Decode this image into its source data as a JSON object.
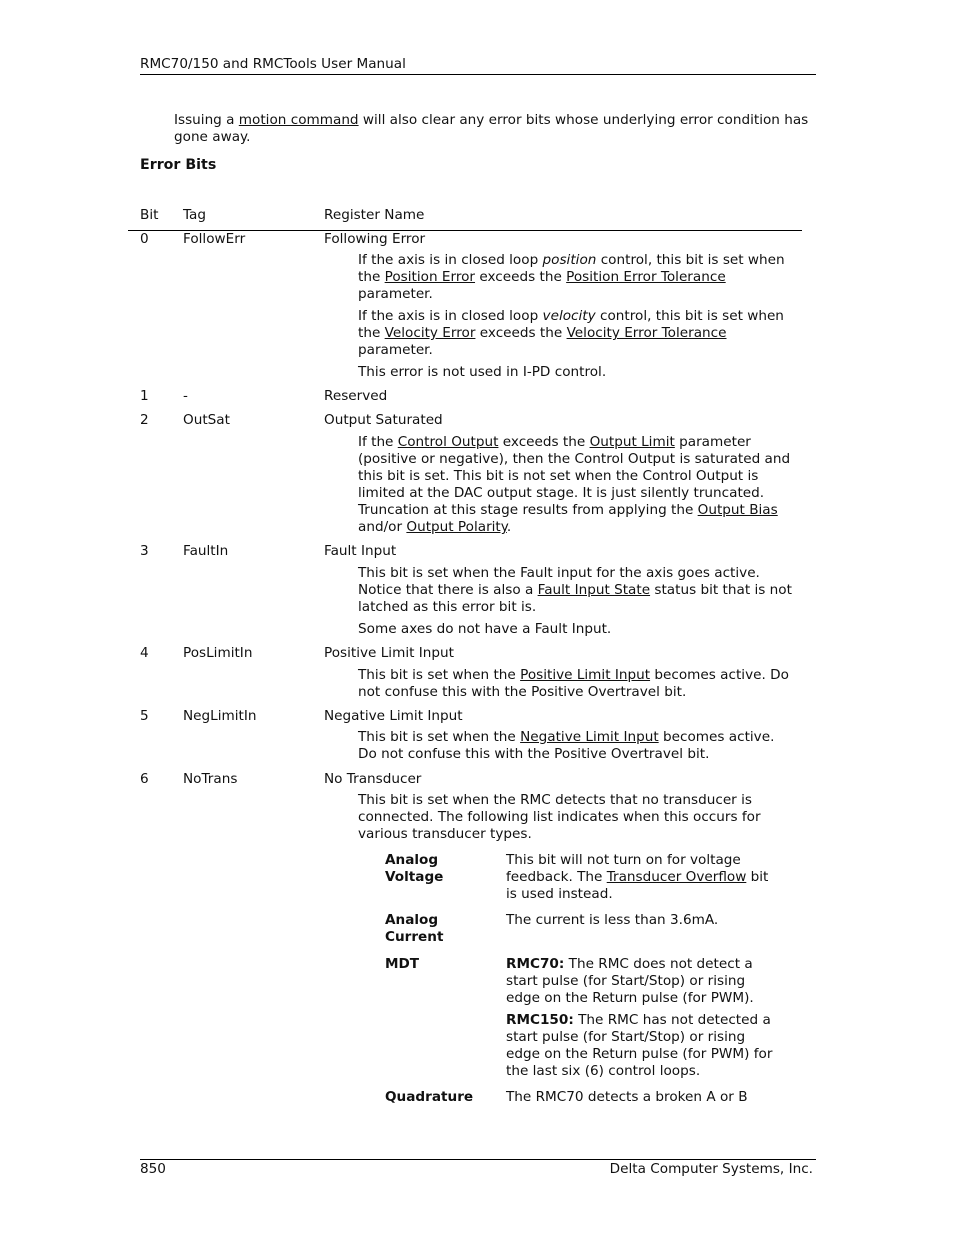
{
  "header": {
    "title": "RMC70/150 and RMCTools User Manual"
  },
  "intro": {
    "pre": "Issuing a ",
    "link": "motion command",
    "post": " will also clear any error bits whose underlying error condition has gone away."
  },
  "section_title": "Error Bits",
  "table": {
    "headers": {
      "bit": "Bit",
      "tag": "Tag",
      "register": "Register Name"
    },
    "rows": [
      {
        "bit": "0",
        "tag": "FollowErr",
        "register": "Following Error"
      },
      {
        "bit": "1",
        "tag": "-",
        "register": "Reserved"
      },
      {
        "bit": "2",
        "tag": "OutSat",
        "register": "Output Saturated"
      },
      {
        "bit": "3",
        "tag": "FaultIn",
        "register": "Fault Input"
      },
      {
        "bit": "4",
        "tag": "PosLimitIn",
        "register": "Positive Limit Input"
      },
      {
        "bit": "5",
        "tag": "NegLimitIn",
        "register": "Negative Limit Input"
      },
      {
        "bit": "6",
        "tag": "NoTrans",
        "register": "No Transducer"
      }
    ]
  },
  "descriptions": {
    "followerr": {
      "p1": {
        "a": "If the axis is in closed loop ",
        "em": "position",
        "b": " control, this bit is set when the ",
        "l1": "Position Error",
        "c": " exceeds the ",
        "l2": "Position Error Tolerance",
        "d": " parameter."
      },
      "p2": {
        "a": "If the axis is in closed loop ",
        "em": "velocity",
        "b": " control, this bit is set when the ",
        "l1": "Velocity Error",
        "c": " exceeds the ",
        "l2": "Velocity Error Tolerance",
        "d": " parameter."
      },
      "p3": "This error is not used in I-PD control."
    },
    "outsat": {
      "a": "If the ",
      "l1": "Control Output",
      "b": " exceeds the ",
      "l2": "Output Limit",
      "c": " parameter (positive or negative), then the Control Output is saturated and this bit is set. This bit is not set when the Control Output is limited at the DAC output stage. It is just silently truncated. Truncation at this stage results from applying the ",
      "l3": "Output Bias",
      "d": " and/or ",
      "l4": "Output Polarity",
      "e": "."
    },
    "faultin": {
      "p1": {
        "a": "This bit is set when the Fault input for the axis goes active. Notice that there is also a ",
        "l1": "Fault Input State",
        "b": " status bit that is not latched as this error bit is."
      },
      "p2": "Some axes do not have a Fault Input."
    },
    "poslimit": {
      "a": "This bit is set when the ",
      "l1": "Positive Limit Input",
      "b": " becomes active. Do not confuse this with the Positive Overtravel bit."
    },
    "neglimit": {
      "a": "This bit is set when the ",
      "l1": "Negative Limit Input",
      "b": " becomes active. Do not confuse this with the Positive Overtravel bit."
    },
    "notrans": {
      "intro": "This bit is set when the RMC detects that no transducer is connected. The following list indicates when this occurs for various transducer types.",
      "types": [
        {
          "term": "Analog Voltage",
          "a": "This bit will not turn on for voltage feedback. The ",
          "l1": "Transducer Overflow",
          "b": " bit is used instead."
        },
        {
          "term": "Analog Current",
          "text": "The current is less than 3.6mA."
        },
        {
          "term": "MDT",
          "b1": "RMC70:",
          "t1": " The RMC does not detect a start pulse (for Start/Stop) or rising edge on the Return pulse (for PWM).",
          "b2": "RMC150:",
          "t2": " The RMC has not detected a start pulse (for Start/Stop) or rising edge on the Return pulse (for PWM) for the last six (6) control loops."
        },
        {
          "term": "Quadrature",
          "text": "The RMC70 detects a broken A or B"
        }
      ]
    }
  },
  "footer": {
    "page_number": "850",
    "company": "Delta Computer Systems, Inc."
  }
}
